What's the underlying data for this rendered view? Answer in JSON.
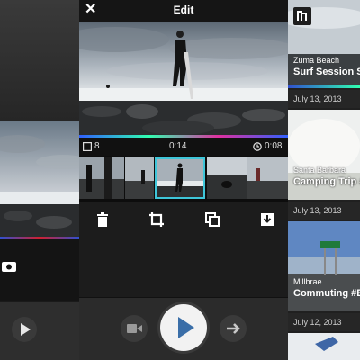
{
  "editor": {
    "title": "Edit",
    "clip_count": "8",
    "current_time": "0:14",
    "clip_duration": "0:08"
  },
  "feed": {
    "items": [
      {
        "location": "Zuma Beach",
        "title": "Surf Session Su",
        "date": "July 13, 2013"
      },
      {
        "location": "Santa Barbara",
        "title": "Camping Trip #",
        "date": "July 13, 2013"
      },
      {
        "location": "Millbrae",
        "title": "Commuting #B",
        "date": "July 12, 2013"
      }
    ]
  },
  "icons": {
    "close": "close-icon",
    "logo": "app-logo-icon",
    "clips": "clips-icon",
    "clock": "clock-icon",
    "delete": "trash-icon",
    "crop": "crop-icon",
    "duplicate": "duplicate-icon",
    "save": "download-icon",
    "camera": "video-camera-icon",
    "play": "play-icon",
    "next": "arrow-right-icon"
  },
  "colors": {
    "selection": "#3ec6d9",
    "play_button": "#f2f2f2",
    "play_triangle": "#3a6ea8"
  }
}
